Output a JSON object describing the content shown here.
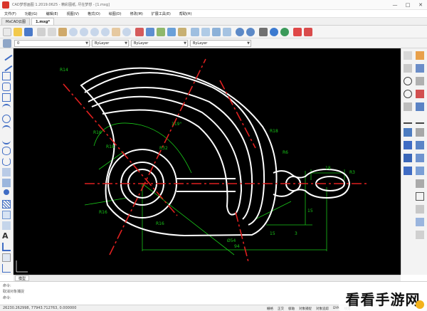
{
  "window": {
    "title": "CAD梦想画图 1.2019.0625 - 精彩图纸, 尽在梦想 - [1.mxg]",
    "controls": [
      "—",
      "□",
      "✕"
    ]
  },
  "menu": [
    "文件(F)",
    "功能(G)",
    "编辑(E)",
    "视图(V)",
    "格式(O)",
    "绘图(D)",
    "修改(M)",
    "扩展工具(E)",
    "帮助(H)"
  ],
  "tabs": [
    {
      "label": "MxCAD云图"
    },
    {
      "label": "1.mxg*"
    }
  ],
  "property_bar": {
    "layer_value": "0",
    "color_value": "ByLayer",
    "linetype_value": "ByLayer",
    "lineweight_value": "ByLayer"
  },
  "layout_tabs": [
    "模型"
  ],
  "command": {
    "history": "命令:",
    "current": "取消对象捕捉",
    "prompt": "命令:"
  },
  "status": {
    "coords": "26230.262998, 77943.712763, 0.000000",
    "toggles": [
      "栅格",
      "正交",
      "极轴",
      "对象捕捉",
      "对象追踪",
      "DYN",
      "线宽"
    ]
  },
  "drawing": {
    "dimensions": [
      "R14",
      "R16",
      "R18",
      "R32",
      "R16",
      "R16",
      "R18",
      "119°",
      "R6",
      "18",
      "R3",
      "15",
      "Ø54",
      "94",
      "3",
      "15"
    ],
    "colors": {
      "background": "#000000",
      "outline": "#ffffff",
      "centerline": "#e02020",
      "dimension": "#19c419"
    }
  },
  "watermark": {
    "text": "看看手游网"
  }
}
